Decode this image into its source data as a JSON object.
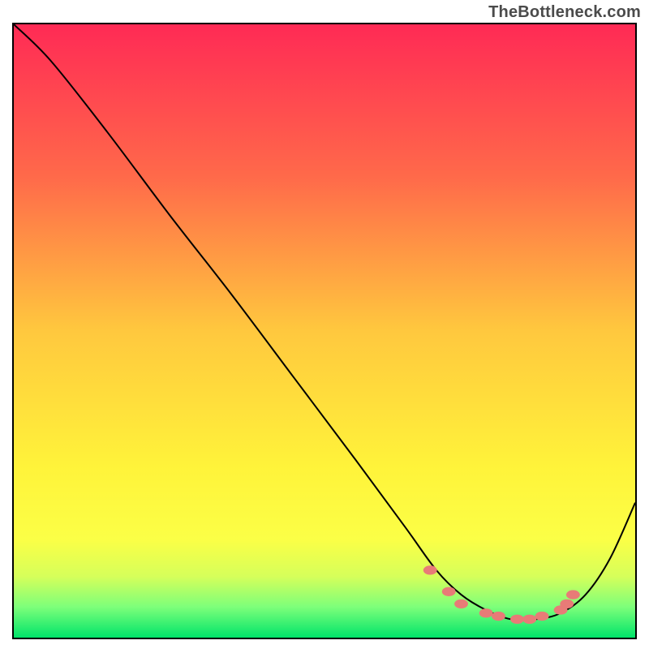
{
  "attribution": "TheBottleneck.com",
  "chart_data": {
    "type": "line",
    "title": "",
    "xlabel": "",
    "ylabel": "",
    "xlim": [
      0,
      100
    ],
    "ylim": [
      0,
      100
    ],
    "background_gradient": [
      {
        "stop": 0.0,
        "color": "#ff2a55"
      },
      {
        "stop": 0.25,
        "color": "#ff6a4a"
      },
      {
        "stop": 0.5,
        "color": "#ffc83e"
      },
      {
        "stop": 0.72,
        "color": "#fff33a"
      },
      {
        "stop": 0.84,
        "color": "#fbff46"
      },
      {
        "stop": 0.9,
        "color": "#d6ff5a"
      },
      {
        "stop": 0.95,
        "color": "#7dff7a"
      },
      {
        "stop": 1.0,
        "color": "#00e46a"
      }
    ],
    "series": [
      {
        "name": "bottleneck-curve",
        "x": [
          0,
          6,
          15,
          25,
          35,
          45,
          55,
          63,
          68,
          72,
          76,
          80,
          84,
          88,
          92,
          96,
          100
        ],
        "y": [
          100,
          94,
          82.5,
          69,
          56,
          42.5,
          29,
          18,
          11,
          7,
          4.5,
          3,
          3,
          4,
          7,
          13,
          22
        ]
      }
    ],
    "markers": {
      "name": "highlight-dots",
      "color": "#e87b77",
      "points": [
        {
          "x": 67,
          "y": 11
        },
        {
          "x": 70,
          "y": 7.5
        },
        {
          "x": 72,
          "y": 5.5
        },
        {
          "x": 76,
          "y": 4
        },
        {
          "x": 78,
          "y": 3.5
        },
        {
          "x": 81,
          "y": 3
        },
        {
          "x": 83,
          "y": 3
        },
        {
          "x": 85,
          "y": 3.5
        },
        {
          "x": 88,
          "y": 4.5
        },
        {
          "x": 89,
          "y": 5.5
        },
        {
          "x": 90,
          "y": 7
        }
      ]
    }
  }
}
